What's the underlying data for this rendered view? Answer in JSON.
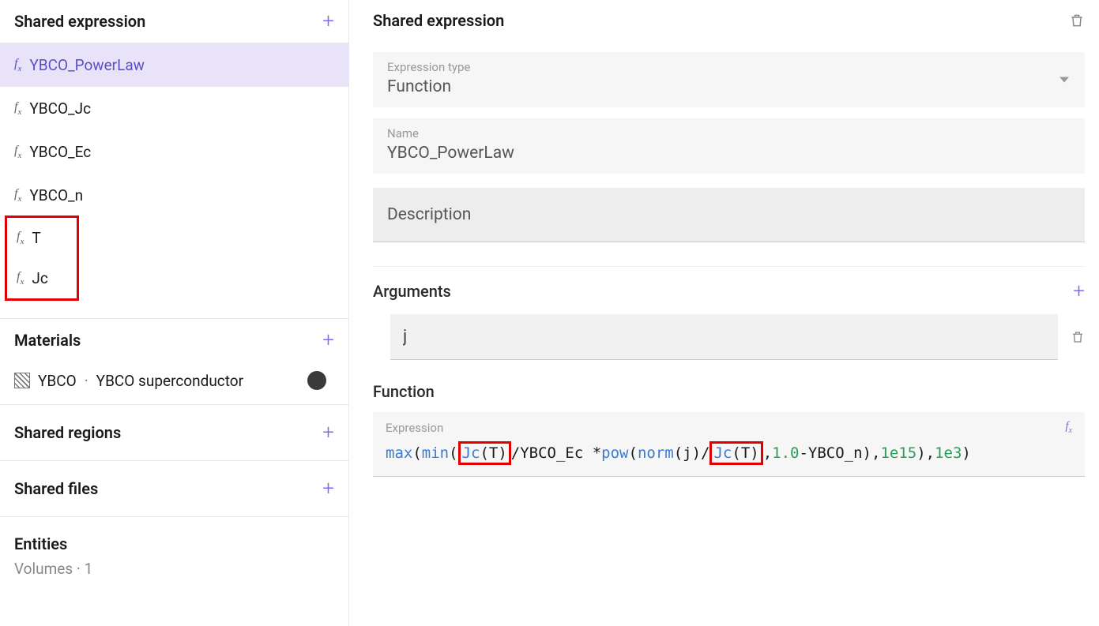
{
  "sidebar": {
    "shared_expression_title": "Shared expression",
    "expressions": [
      {
        "name": "YBCO_PowerLaw",
        "selected": true
      },
      {
        "name": "YBCO_Jc",
        "selected": false
      },
      {
        "name": "YBCO_Ec",
        "selected": false
      },
      {
        "name": "YBCO_n",
        "selected": false
      },
      {
        "name": "T",
        "selected": false,
        "highlighted": true
      },
      {
        "name": "Jc",
        "selected": false,
        "highlighted": true
      }
    ],
    "materials_title": "Materials",
    "material": {
      "code": "YBCO",
      "desc": "YBCO superconductor"
    },
    "shared_regions_title": "Shared regions",
    "shared_files_title": "Shared files",
    "entities_title": "Entities",
    "volumes_label": "Volumes",
    "volumes_count": "1"
  },
  "main": {
    "title": "Shared expression",
    "type_label": "Expression type",
    "type_value": "Function",
    "name_label": "Name",
    "name_value": "YBCO_PowerLaw",
    "description_placeholder": "Description",
    "arguments_title": "Arguments",
    "argument_value": "j",
    "function_title": "Function",
    "expression_label": "Expression",
    "expression": {
      "tokens": [
        {
          "t": "fn",
          "v": "max"
        },
        {
          "t": "p",
          "v": "("
        },
        {
          "t": "fn",
          "v": "min"
        },
        {
          "t": "p",
          "v": "("
        },
        {
          "t": "hl_open",
          "v": ""
        },
        {
          "t": "fn",
          "v": "Jc"
        },
        {
          "t": "p",
          "v": "(T)"
        },
        {
          "t": "hl_close",
          "v": ""
        },
        {
          "t": "p",
          "v": "/YBCO_Ec * "
        },
        {
          "t": "fn",
          "v": "pow"
        },
        {
          "t": "p",
          "v": "("
        },
        {
          "t": "fn",
          "v": "norm"
        },
        {
          "t": "p",
          "v": "(j)/"
        },
        {
          "t": "hl_open",
          "v": ""
        },
        {
          "t": "fn",
          "v": "Jc"
        },
        {
          "t": "p",
          "v": "(T)"
        },
        {
          "t": "hl_close",
          "v": ""
        },
        {
          "t": "p",
          "v": ", "
        },
        {
          "t": "num",
          "v": "1.0"
        },
        {
          "t": "p",
          "v": "-YBCO_n), "
        },
        {
          "t": "num",
          "v": "1e15"
        },
        {
          "t": "p",
          "v": "), "
        },
        {
          "t": "num",
          "v": "1e3"
        },
        {
          "t": "p",
          "v": ")"
        }
      ]
    }
  }
}
